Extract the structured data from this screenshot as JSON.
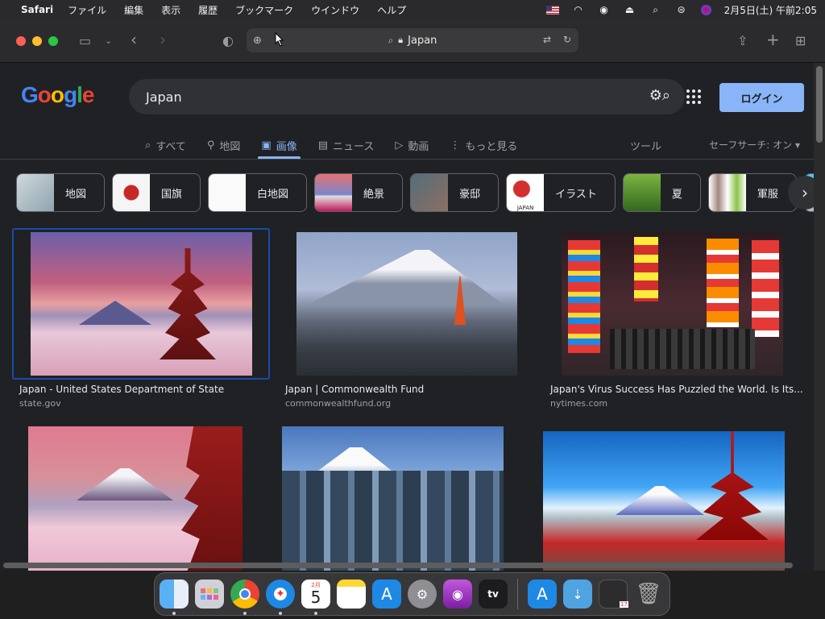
{
  "menubar": {
    "app_name": "Safari",
    "items": [
      "ファイル",
      "編集",
      "表示",
      "履歴",
      "ブックマーク",
      "ウインドウ",
      "ヘルプ"
    ],
    "clock": "2月5日(土) 午前2:05"
  },
  "toolbar": {
    "address": "Japan"
  },
  "google": {
    "logo": "Google",
    "query": "Japan",
    "login": "ログイン",
    "tabs": [
      {
        "icon": "⌕",
        "label": "すべて"
      },
      {
        "icon": "⚲",
        "label": "地図"
      },
      {
        "icon": "▣",
        "label": "画像"
      },
      {
        "icon": "▤",
        "label": "ニュース"
      },
      {
        "icon": "▷",
        "label": "動画"
      },
      {
        "icon": "⋮",
        "label": "もっと見る"
      }
    ],
    "tools": "ツール",
    "safesearch": "セーフサーチ: オン ▾"
  },
  "chips": [
    {
      "label": "地図"
    },
    {
      "label": "国旗"
    },
    {
      "label": "白地図"
    },
    {
      "label": "絶景"
    },
    {
      "label": "豪邸"
    },
    {
      "label": "イラスト"
    },
    {
      "label": "夏"
    },
    {
      "label": "軍服"
    }
  ],
  "chip_thumb_text": {
    "illustration": "JAPAN"
  },
  "results": [
    {
      "title": "Japan - United States Department of State",
      "source": "state.gov"
    },
    {
      "title": "Japan | Commonwealth Fund",
      "source": "commonwealthfund.org"
    },
    {
      "title": "Japan's Virus Success Has Puzzled the World. Is Its...",
      "source": "nytimes.com"
    }
  ],
  "dock": {
    "calendar_month": "2月",
    "calendar_day": "5",
    "tv_label": "tv",
    "downloads_badge": "17"
  }
}
